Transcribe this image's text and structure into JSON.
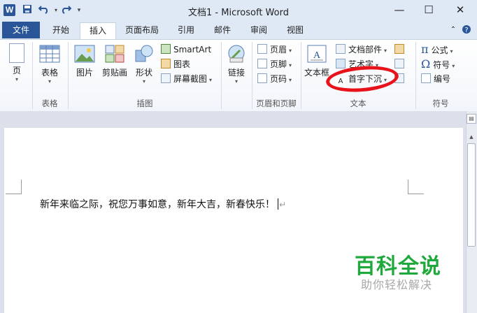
{
  "window": {
    "title": "文档1 - Microsoft Word",
    "app_logo": "W"
  },
  "quick_access": {
    "save_icon": "save-icon",
    "undo_icon": "undo-icon",
    "redo_icon": "redo-icon"
  },
  "window_controls": {
    "minimize": "—",
    "maximize": "☐",
    "close": "✕"
  },
  "tabs": {
    "file": "文件",
    "items": [
      "开始",
      "插入",
      "页面布局",
      "引用",
      "邮件",
      "审阅",
      "视图"
    ],
    "active": "插入"
  },
  "ribbon": {
    "pages": {
      "label": "页",
      "group": ""
    },
    "tables": {
      "label": "表格",
      "group": "表格"
    },
    "illustrations": {
      "group": "插图",
      "picture": "图片",
      "clipart": "剪贴画",
      "shapes": "形状",
      "smartart": "SmartArt",
      "chart": "图表",
      "screenshot": "屏幕截图"
    },
    "links": {
      "label": "链接",
      "group": ""
    },
    "header_footer": {
      "group": "页眉和页脚",
      "header": "页眉",
      "footer": "页脚",
      "page_number": "页码"
    },
    "text": {
      "group": "文本",
      "textbox": "文本框",
      "quick_parts": "文档部件",
      "wordart": "艺术字",
      "dropcap": "首字下沉"
    },
    "symbols": {
      "group": "符号",
      "equation": "公式",
      "symbol": "符号",
      "number": "编号",
      "equation_glyph": "π",
      "symbol_glyph": "Ω"
    }
  },
  "document": {
    "text": "新年来临之际，祝您万事如意，新年大吉，新春快乐！"
  },
  "watermark": {
    "title": "百科全说",
    "subtitle": "助你轻松解决"
  },
  "colors": {
    "accent": "#2a5699",
    "annotation": "#e8121a",
    "watermark": "#1fa83c"
  }
}
